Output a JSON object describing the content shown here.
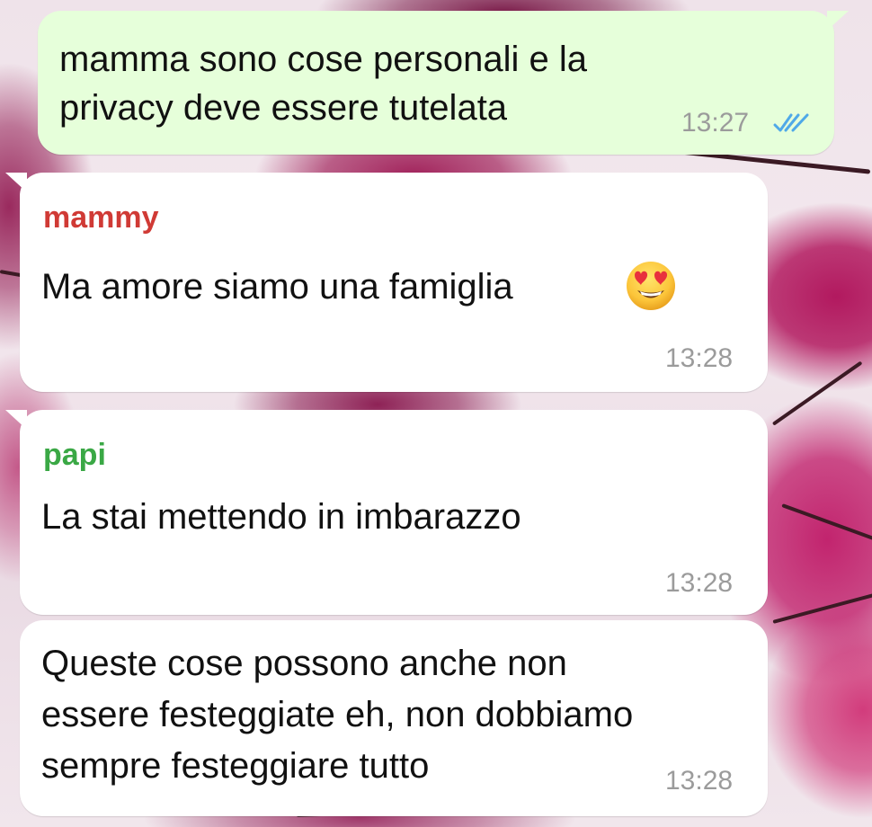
{
  "chat": {
    "messages": [
      {
        "direction": "outgoing",
        "lines": [
          "mamma sono cose personali e la",
          "privacy deve essere tutelata"
        ],
        "time": "13:27",
        "status_icon": "double-check-read-icon"
      },
      {
        "direction": "incoming",
        "sender": "mammy",
        "sender_color": "#d03a35",
        "text": "Ma amore siamo una famiglia",
        "emoji": "smiling-face-with-heart-eyes-icon",
        "time": "13:28"
      },
      {
        "direction": "incoming",
        "sender": "papi",
        "sender_color": "#3aa845",
        "text": "La stai mettendo in imbarazzo",
        "time": "13:28"
      },
      {
        "direction": "incoming",
        "lines": [
          "Queste cose possono anche non",
          "essere festeggiate eh, non dobbiamo",
          "sempre festeggiare tutto"
        ],
        "time": "13:28"
      }
    ]
  },
  "colors": {
    "outgoing_bubble": "#e6ffda",
    "incoming_bubble": "#ffffff",
    "read_ticks": "#4fa9e8",
    "timestamp": "#9b9b9b"
  }
}
